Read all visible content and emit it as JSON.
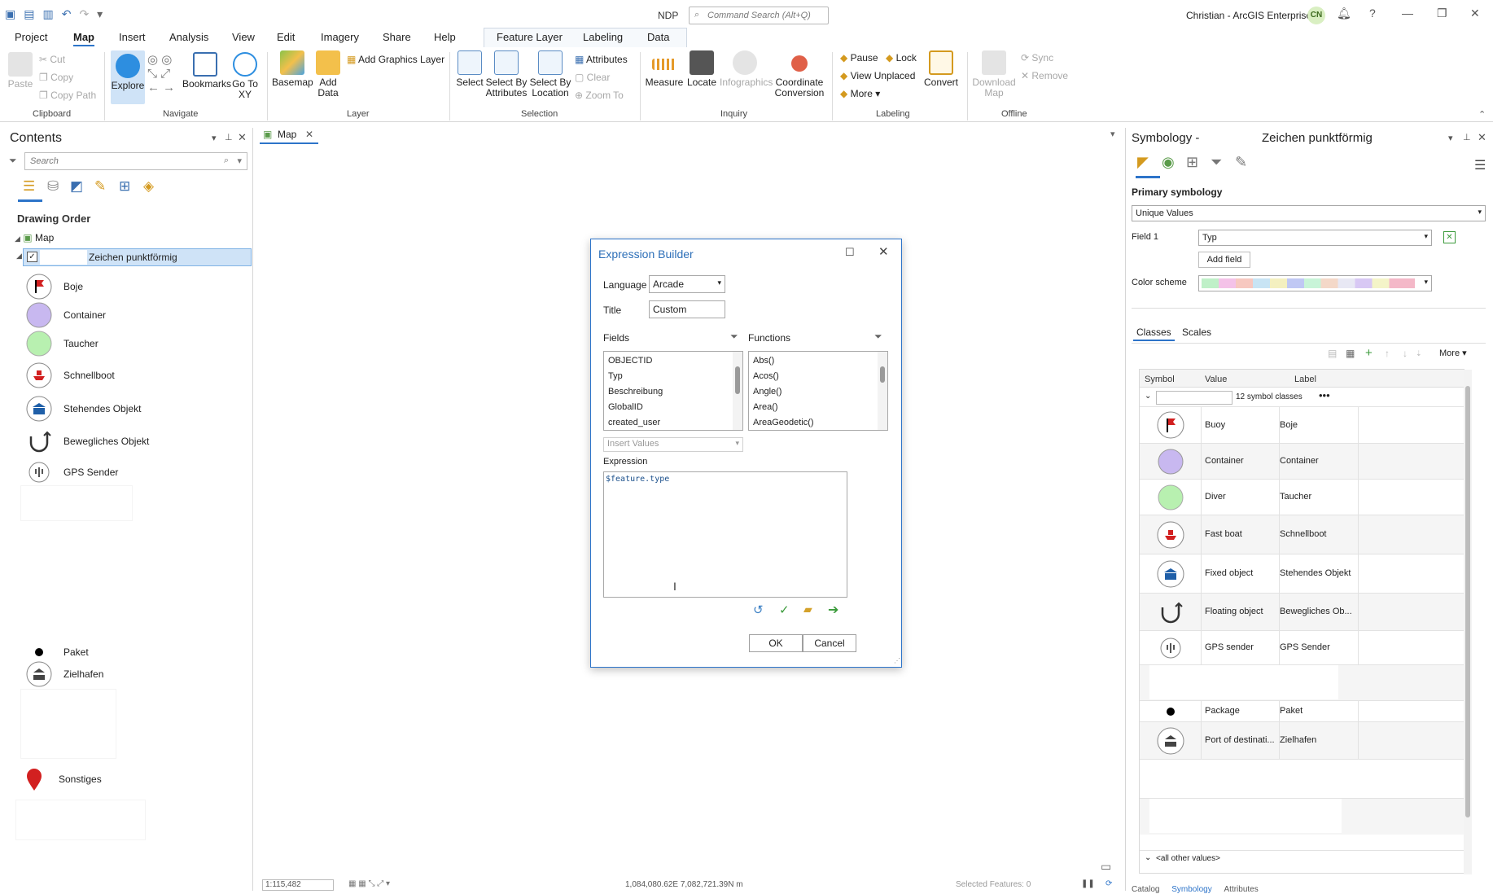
{
  "titlebar": {
    "app": "NDP",
    "search_placeholder": "Command Search (Alt+Q)",
    "user": "Christian - ArcGIS Enterprise",
    "avatar": "CN"
  },
  "tabs": [
    "Project",
    "Map",
    "Insert",
    "Analysis",
    "View",
    "Edit",
    "Imagery",
    "Share",
    "Help",
    "Feature Layer",
    "Labeling",
    "Data"
  ],
  "ribbon": {
    "clipboard": {
      "paste": "Paste",
      "cut": "Cut",
      "copy": "Copy",
      "copy_path": "Copy Path",
      "label": "Clipboard"
    },
    "navigate": {
      "explore": "Explore",
      "bookmarks": "Bookmarks",
      "goto": "Go To XY",
      "label": "Navigate"
    },
    "layer": {
      "basemap": "Basemap",
      "add_data": "Add Data",
      "add_graphics": "Add Graphics Layer",
      "label": "Layer"
    },
    "selection": {
      "select": "Select",
      "by_attr": "Select By Attributes",
      "by_loc": "Select By Location",
      "attributes": "Attributes",
      "clear": "Clear",
      "zoom_to": "Zoom To",
      "label": "Selection"
    },
    "inquiry": {
      "measure": "Measure",
      "locate": "Locate",
      "infographics": "Infographics",
      "coord": "Coordinate Conversion",
      "label": "Inquiry"
    },
    "labeling": {
      "pause": "Pause",
      "lock": "Lock",
      "view_unplaced": "View Unplaced",
      "more": "More",
      "convert": "Convert",
      "label": "Labeling"
    },
    "offline": {
      "download": "Download Map",
      "sync": "Sync",
      "remove": "Remove",
      "label": "Offline"
    }
  },
  "contents": {
    "title": "Contents",
    "search_placeholder": "Search",
    "drawing_order": "Drawing Order",
    "map": "Map",
    "layer": "Zeichen punktförmig",
    "legend": [
      "Boje",
      "Container",
      "Taucher",
      "Schnellboot",
      "Stehendes Objekt",
      "Bewegliches Objekt",
      "GPS Sender",
      "Paket",
      "Zielhafen",
      "Sonstiges"
    ]
  },
  "map_tab": "Map",
  "status": {
    "scale": "1:115,482",
    "coords": "1,084,080.62E 7,082,721.39N m",
    "selected": "Selected Features: 0"
  },
  "dialog": {
    "title": "Expression Builder",
    "language_label": "Language",
    "language": "Arcade",
    "title_label": "Title",
    "title_value": "Custom",
    "fields_label": "Fields",
    "functions_label": "Functions",
    "fields": [
      "OBJECTID",
      "Typ",
      "Beschreibung",
      "GlobalID",
      "created_user"
    ],
    "functions": [
      "Abs()",
      "Acos()",
      "Angle()",
      "Area()",
      "AreaGeodetic()"
    ],
    "insert_values": "Insert Values",
    "expression_label": "Expression",
    "expression": "$feature.type",
    "ok": "OK",
    "cancel": "Cancel"
  },
  "symbology": {
    "title_left": "Symbology -",
    "title_right": "Zeichen punktförmig",
    "primary": "Primary symbology",
    "method": "Unique Values",
    "field1_label": "Field 1",
    "field1": "Typ",
    "add_field": "Add field",
    "color_scheme": "Color scheme",
    "tab_classes": "Classes",
    "tab_scales": "Scales",
    "more": "More",
    "col_symbol": "Symbol",
    "col_value": "Value",
    "col_label": "Label",
    "classes_count": "12 symbol classes",
    "rows": [
      {
        "value": "Buoy",
        "label": "Boje"
      },
      {
        "value": "Container",
        "label": "Container"
      },
      {
        "value": "Diver",
        "label": "Taucher"
      },
      {
        "value": "Fast boat",
        "label": "Schnellboot"
      },
      {
        "value": "Fixed object",
        "label": "Stehendes Objekt"
      },
      {
        "value": "Floating object",
        "label": "Bewegliches Ob..."
      },
      {
        "value": "GPS sender",
        "label": "GPS Sender"
      },
      {
        "value": "Package",
        "label": "Paket"
      },
      {
        "value": "Port of destinati...",
        "label": "Zielhafen"
      }
    ],
    "all_other": "<all other values>",
    "bottom_tabs": [
      "Catalog",
      "Symbology",
      "Attributes"
    ]
  },
  "colors": {
    "accent": "#2d74c9",
    "purple": "#c8b8f0",
    "green": "#b8f0b0",
    "red": "#d22020"
  }
}
